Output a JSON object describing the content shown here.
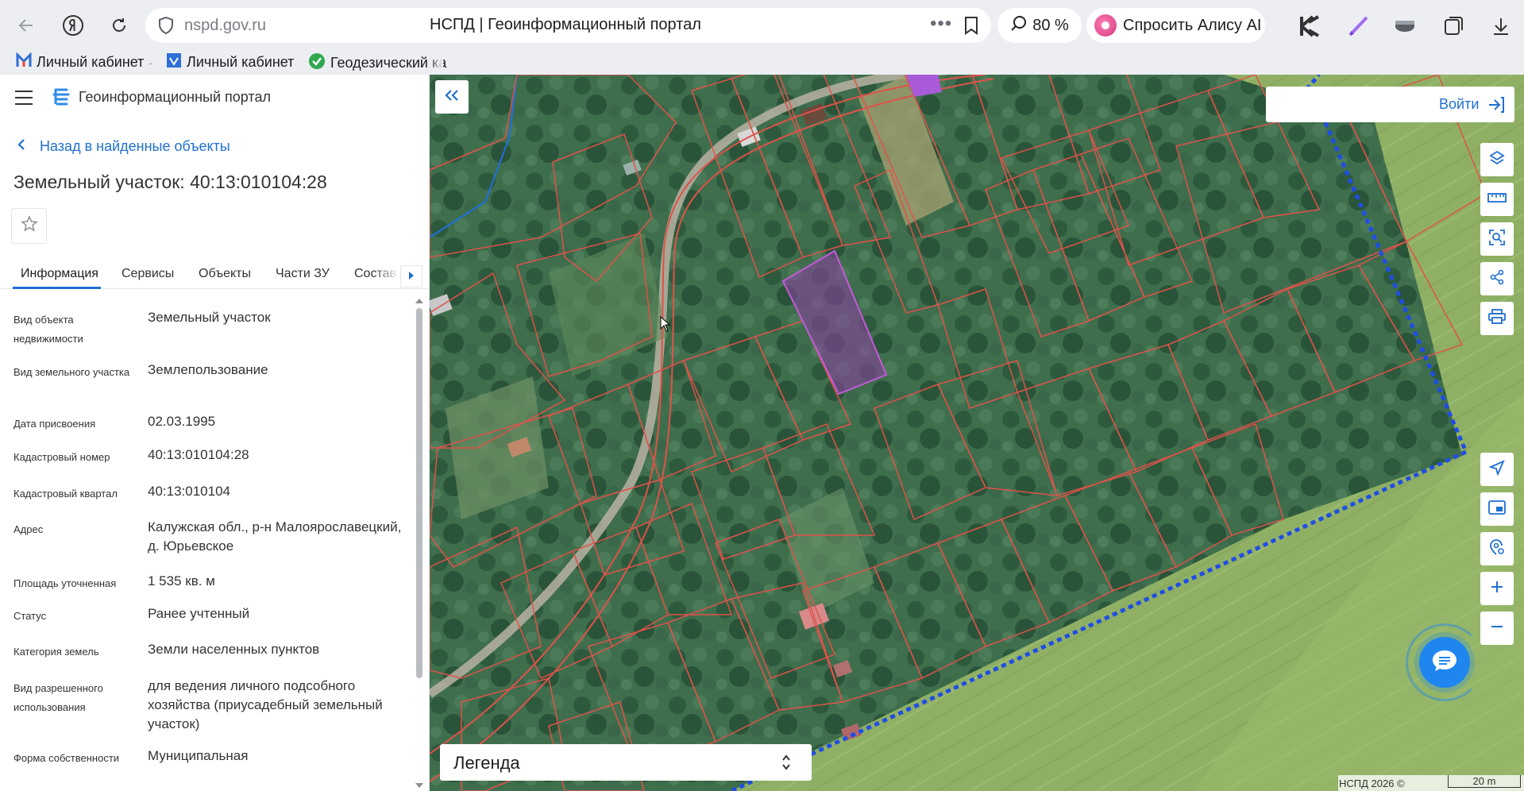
{
  "browser": {
    "host": "nspd.gov.ru",
    "page_title": "НСПД | Геоинформационный портал",
    "zoom": "80 %",
    "alice_label": "Спросить Алису AI",
    "bookmarks": [
      {
        "label": "Личный кабинет"
      },
      {
        "label": "Личный кабинет"
      },
      {
        "label": "Геодезический ка"
      }
    ]
  },
  "panel": {
    "portal_title": "Геоинформационный портал",
    "back_label": "Назад в найденные объекты",
    "object_title": "Земельный участок: 40:13:010104:28",
    "tabs": [
      {
        "label": "Информация",
        "active": true
      },
      {
        "label": "Сервисы"
      },
      {
        "label": "Объекты"
      },
      {
        "label": "Части ЗУ"
      },
      {
        "label": "Состав"
      }
    ],
    "info": [
      {
        "key": "Вид объекта недвижимости",
        "value": "Земельный участок"
      },
      {
        "key": "Вид земельного участка",
        "value": "Землепользование"
      },
      {
        "key": "Дата присвоения",
        "value": "02.03.1995"
      },
      {
        "key": "Кадастровый номер",
        "value": "40:13:010104:28"
      },
      {
        "key": "Кадастровый квартал",
        "value": "40:13:010104"
      },
      {
        "key": "Адрес",
        "value": "Калужская обл., р-н Малоярославецкий, д. Юрьевское"
      },
      {
        "key": "Площадь уточненная",
        "value": "1 535 кв. м"
      },
      {
        "key": "Статус",
        "value": "Ранее учтенный"
      },
      {
        "key": "Категория земель",
        "value": "Земли населенных пунктов"
      },
      {
        "key": "Вид разрешенного использования",
        "value": "для ведения личного подсобного хозяйства (приусадебный земельный участок)"
      },
      {
        "key": "Форма собственности",
        "value": "Муниципальная"
      }
    ]
  },
  "map": {
    "login_label": "Войти",
    "legend_label": "Легенда",
    "copyright": "НСПД 2026 ©",
    "scale_label": "20 m",
    "colors": {
      "parcel_border": "#e0524a",
      "selected_fill": "#8e3fa8",
      "boundary": "#1f4de6",
      "accent": "#1f6fd1"
    }
  }
}
